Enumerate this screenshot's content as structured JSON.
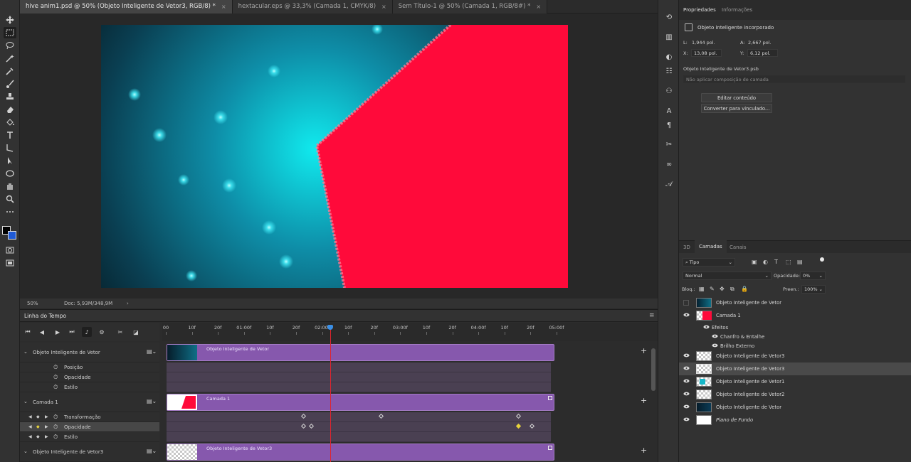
{
  "tabs": [
    {
      "label": "hive anim1.psd @ 50% (Objeto Inteligente de Vetor3, RGB/8) *",
      "active": true
    },
    {
      "label": "hextacular.eps @ 33,3% (Camada 1, CMYK/8)",
      "active": false
    },
    {
      "label": "Sem Título-1 @ 50% (Camada 1, RGB/8#) *",
      "active": false
    }
  ],
  "tab_close": "×",
  "status": {
    "zoom": "50%",
    "doc": "Doc: 5,93M/348,9M",
    "arrow": "›"
  },
  "timeline": {
    "title": "Linha do Tempo",
    "ruler": [
      "00",
      "10f",
      "20f",
      "01:00f",
      "10f",
      "20f",
      "02:00f",
      "10f",
      "20f",
      "03:00f",
      "10f",
      "20f",
      "04:00f",
      "10f",
      "20f",
      "05:00f"
    ],
    "playhead_fraction": 0.42,
    "tracks": [
      {
        "name": "Objeto Inteligente de Vetor",
        "clip": "Objeto Inteligente de Vetor",
        "props": [
          "Posição",
          "Opacidade",
          "Estilo"
        ]
      },
      {
        "name": "Camada 1",
        "clip": "Camada 1",
        "props": [
          "Transformação",
          "Opacidade",
          "Estilo"
        ]
      },
      {
        "name": "Objeto Inteligente de Vetor3",
        "clip": "Objeto Inteligente de Vetor3",
        "props": []
      }
    ]
  },
  "properties": {
    "tabs": [
      "Propriedades",
      "Informações"
    ],
    "type": "Objeto inteligente incorporado",
    "L_label": "L:",
    "L": "1,944 pol.",
    "A_label": "A:",
    "A": "2,667 pol.",
    "X_label": "X:",
    "X": "13,08 pol.",
    "Y_label": "Y:",
    "Y": "6,12 pol.",
    "source": "Objeto Inteligente de Vetor3.psb",
    "comp": "Não aplicar composição de camada",
    "edit_btn": "Editar conteúdo",
    "convert_btn": "Converter para vinculado..."
  },
  "layers_panel": {
    "tabs": [
      "3D",
      "Camadas",
      "Canais"
    ],
    "filter": "Tipo",
    "blend": "Normal",
    "opacity_label": "Opacidade:",
    "opacity": "0%",
    "lock_label": "Bloq.:",
    "fill_label": "Preen.:",
    "fill": "100%",
    "layers": [
      {
        "name": "Objeto Inteligente de Vetor",
        "visible": false
      },
      {
        "name": "Camada 1",
        "visible": true
      },
      {
        "name": "Efeitos",
        "visible": true
      },
      {
        "name": "Chanfro & Entalhe",
        "visible": true
      },
      {
        "name": "Brilho Externo",
        "visible": true
      },
      {
        "name": "Objeto Inteligente de Vetor3",
        "visible": true
      },
      {
        "name": "Objeto Inteligente de Vetor3",
        "visible": true,
        "selected": true
      },
      {
        "name": "Objeto Inteligente de Vetor1",
        "visible": true
      },
      {
        "name": "Objeto Inteligente de Vetor2",
        "visible": true
      },
      {
        "name": "Objeto Inteligente de Vetor",
        "visible": true
      },
      {
        "name": "Plano de Fundo",
        "visible": true
      }
    ]
  },
  "colors": {
    "accent": "#8658ad",
    "playhead": "#e0242e",
    "canvas_red": "#ff0a3a",
    "canvas_teal": "#16b7c8"
  }
}
